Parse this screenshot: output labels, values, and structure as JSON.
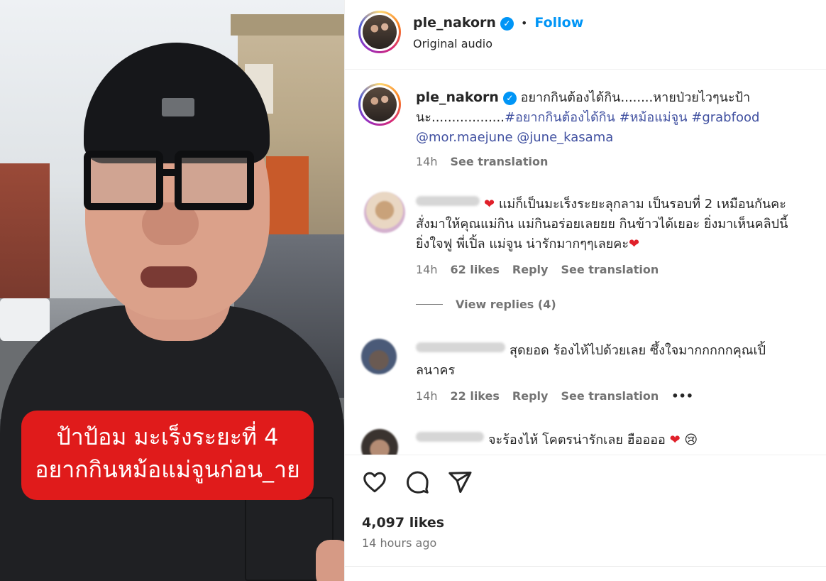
{
  "media": {
    "caption_line1": "ป้าป้อม มะเร็งระยะที่ 4",
    "caption_line2": "อยากกินหม้อแม่จูนก่อน_าย"
  },
  "header": {
    "username": "ple_nakorn",
    "verified_icon": "check",
    "dot": "•",
    "follow_label": "Follow",
    "subtitle": "Original audio"
  },
  "post": {
    "username": "ple_nakorn",
    "text_main": "อยากกินต้องได้กิน........หายป่วยไวๆนะป้า",
    "text_line2_plain": "นะ..................",
    "tags_line2": "#อยากกินต้องได้กิน #หม้อแม่จูน #grabfood",
    "mentions": "@mor.maejune @june_kasama",
    "time": "14h",
    "see_translation": "See translation"
  },
  "comments": [
    {
      "text_line1": "แม่ก็เป็นมะเร็งระยะลุกลาม เป็นรอบที่ 2 เหมือนกันคะ",
      "text_line2": "สั่งมาให้คุณแม่กิน แม่กินอร่อยเลยยย กินข้าวได้เยอะ ยิ่งมาเห็นคลิปนี้",
      "text_line3": "ยิ่งใจฟู พี่เปิ้ล แม่จูน น่ารักมากๆๆเลยคะ",
      "time": "14h",
      "likes": "62 likes",
      "reply": "Reply",
      "see_translation": "See translation",
      "view_replies": "View replies (4)"
    },
    {
      "text_line1": "สุดยอด ร้องไห้ไปด้วยเลย ซึ้งใจมากกกกกคุณเปิ้",
      "text_line2": "ลนาคร",
      "time": "14h",
      "likes": "22 likes",
      "reply": "Reply",
      "see_translation": "See translation",
      "more": "•••"
    },
    {
      "text_line1": "จะร้องไห้ โคตรน่ารักเลย ฮืออออ"
    }
  ],
  "actions": {
    "likes": "4,097 likes",
    "time": "14 hours ago"
  },
  "colors": {
    "accent": "#0095f6",
    "caption_bg": "#e01b1b",
    "hashtag": "#4050a0",
    "secondary_text": "#737373"
  }
}
